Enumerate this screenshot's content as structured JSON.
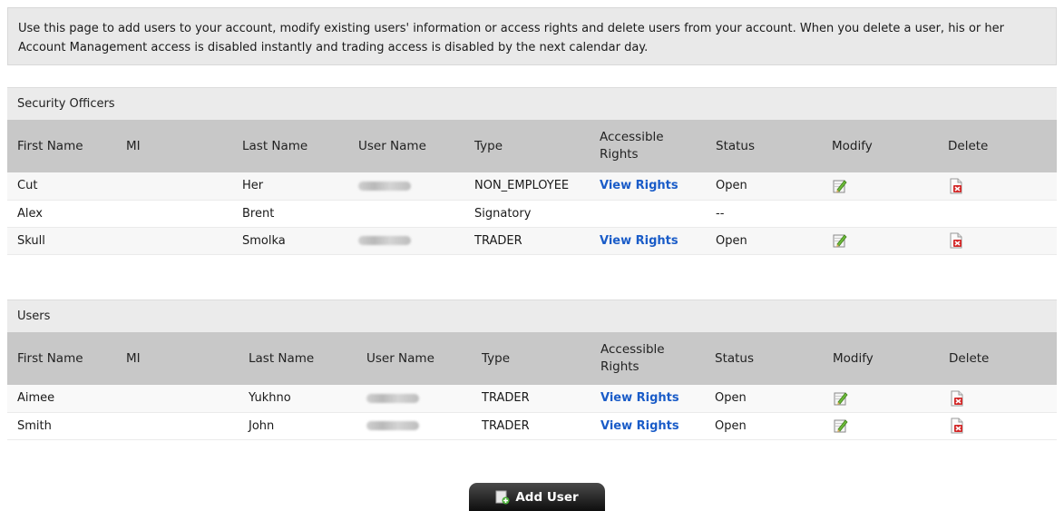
{
  "info": {
    "text": "Use this page to add users to your account, modify existing users' information or access rights and delete users from your account. When you delete a user, his or her Account Management access is disabled instantly and trading access is disabled by the next calendar day."
  },
  "columns": [
    "First Name",
    "MI",
    "Last Name",
    "User Name",
    "Type",
    "Accessible Rights",
    "Status",
    "Modify",
    "Delete"
  ],
  "security_officers": {
    "title": "Security Officers",
    "rows": [
      {
        "first": "Cut",
        "mi": "",
        "last": "Her",
        "username_blurred": true,
        "type": "NON_EMPLOYEE",
        "rights": "View Rights",
        "status": "Open",
        "modify": true,
        "delete": true
      },
      {
        "first": "Alex",
        "mi": "",
        "last": "Brent",
        "username_blurred": false,
        "type": "Signatory",
        "rights": "",
        "status": "--",
        "modify": false,
        "delete": false
      },
      {
        "first": "Skull",
        "mi": "",
        "last": "Smolka",
        "username_blurred": true,
        "type": "TRADER",
        "rights": "View Rights",
        "status": "Open",
        "modify": true,
        "delete": true
      }
    ]
  },
  "users": {
    "title": "Users",
    "rows": [
      {
        "first": "Aimee",
        "mi": "",
        "last": "Yukhno",
        "username_blurred": true,
        "type": "TRADER",
        "rights": "View Rights",
        "status": "Open",
        "modify": true,
        "delete": true
      },
      {
        "first": "Smith",
        "mi": "",
        "last": "John",
        "username_blurred": true,
        "type": "TRADER",
        "rights": "View Rights",
        "status": "Open",
        "modify": true,
        "delete": true
      }
    ]
  },
  "add_user_label": "Add User",
  "colors": {
    "link": "#1a5cc8",
    "header_bg": "#c8c8c8",
    "delete_red": "#d42a2a",
    "modify_green": "#6dbb3a"
  },
  "icons": {
    "modify": "edit-icon",
    "delete": "delete-document-icon",
    "add_user": "add-user-icon"
  }
}
